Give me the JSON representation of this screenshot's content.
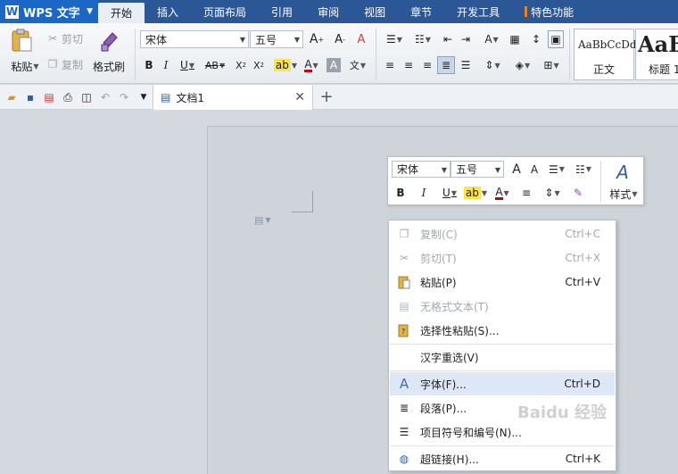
{
  "menubar": {
    "app_title": "WPS 文字",
    "tabs": [
      {
        "label": "开始"
      },
      {
        "label": "插入"
      },
      {
        "label": "页面布局"
      },
      {
        "label": "引用"
      },
      {
        "label": "审阅"
      },
      {
        "label": "视图"
      },
      {
        "label": "章节"
      },
      {
        "label": "开发工具"
      },
      {
        "label": "特色功能"
      }
    ]
  },
  "ribbon": {
    "paste_label": "粘贴",
    "cut_label": "剪切",
    "copy_label": "复制",
    "format_painter_label": "格式刷",
    "font_name": "宋体",
    "font_size": "五号",
    "style_normal_preview": "AaBbCcDd",
    "style_normal_label": "正文",
    "style_heading_preview": "AaB",
    "style_heading_label": "标题 1"
  },
  "tabs_bar": {
    "document_name": "文档1"
  },
  "mini_toolbar": {
    "font_name": "宋体",
    "font_size": "五号",
    "styles_label": "样式"
  },
  "context_menu": {
    "items": [
      {
        "label": "复制(C)",
        "shortcut": "Ctrl+C",
        "icon": "copy-icon",
        "enabled": false
      },
      {
        "label": "剪切(T)",
        "shortcut": "Ctrl+X",
        "icon": "scissors-icon",
        "enabled": false
      },
      {
        "label": "粘贴(P)",
        "shortcut": "Ctrl+V",
        "icon": "paste-icon",
        "enabled": true
      },
      {
        "label": "无格式文本(T)",
        "shortcut": "",
        "icon": "paste-plain-icon",
        "enabled": false
      },
      {
        "label": "选择性粘贴(S)...",
        "shortcut": "",
        "icon": "paste-special-icon",
        "enabled": true
      },
      {
        "label": "汉字重选(V)",
        "shortcut": "",
        "icon": "",
        "enabled": true
      },
      {
        "label": "字体(F)...",
        "shortcut": "Ctrl+D",
        "icon": "font-icon",
        "enabled": true
      },
      {
        "label": "段落(P)...",
        "shortcut": "",
        "icon": "paragraph-icon",
        "enabled": true
      },
      {
        "label": "项目符号和编号(N)...",
        "shortcut": "",
        "icon": "bullets-icon",
        "enabled": true
      },
      {
        "label": "超链接(H)...",
        "shortcut": "Ctrl+K",
        "icon": "hyperlink-icon",
        "enabled": true
      }
    ]
  },
  "watermark": "Baidu 经验"
}
